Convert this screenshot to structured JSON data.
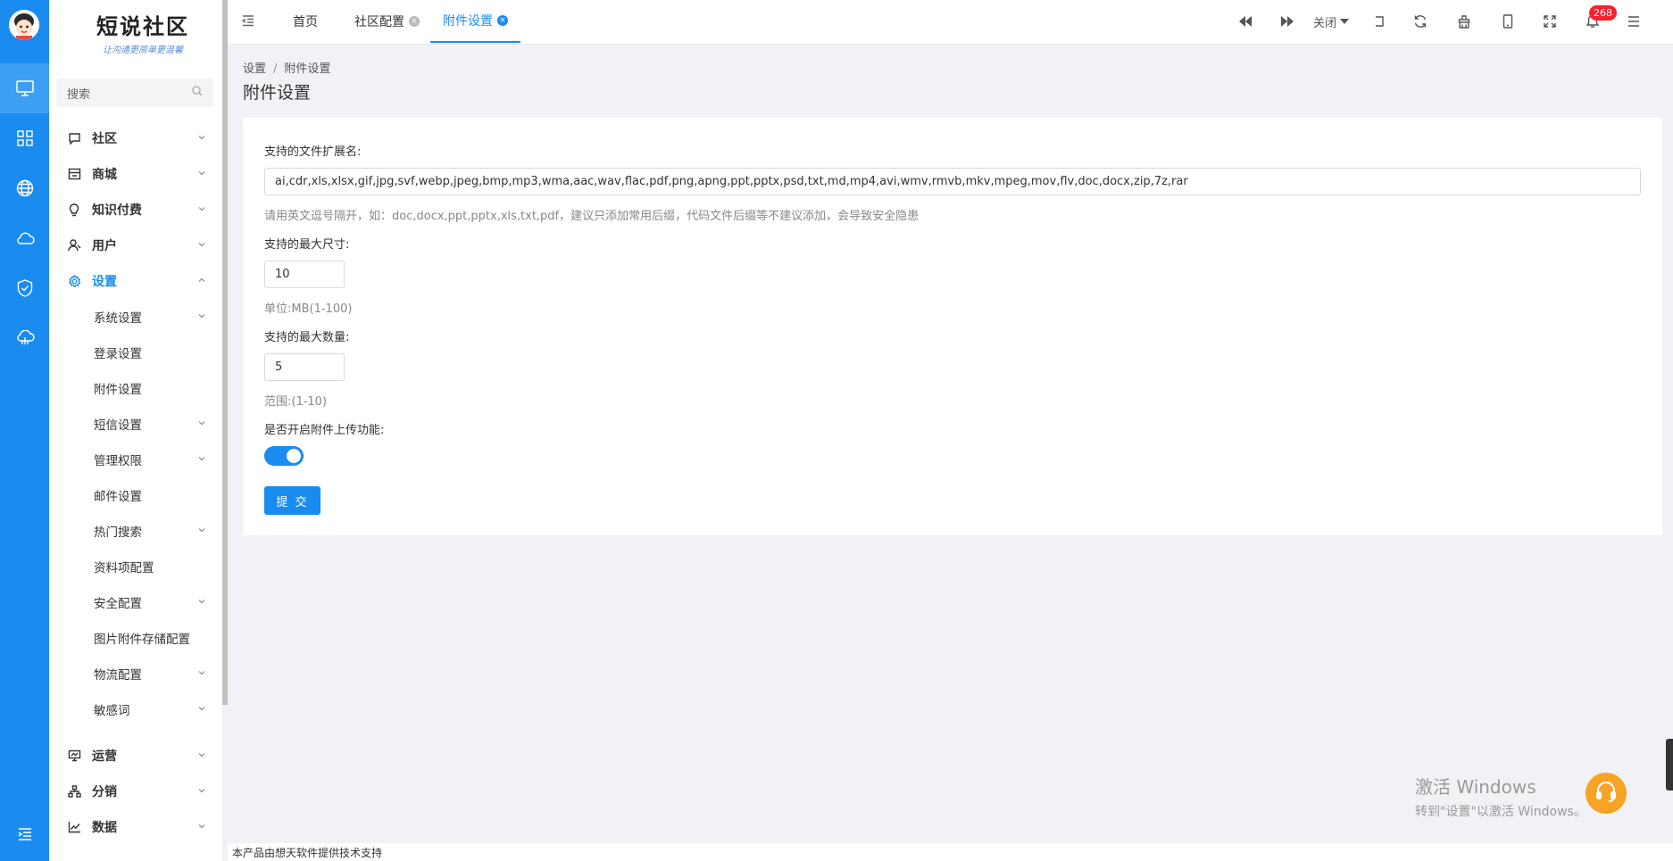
{
  "logo": {
    "title": "短说社区",
    "subtitle": "让沟通更简单更温馨"
  },
  "rail": {
    "items": [
      "monitor-icon",
      "grid-icon",
      "globe-icon",
      "cloud-icon",
      "shield-icon",
      "cloud-network-icon"
    ],
    "bottom": "menu-fold-icon"
  },
  "sidebar": {
    "search_placeholder": "搜索",
    "menu": [
      {
        "label": "社区",
        "icon": "chat-icon"
      },
      {
        "label": "商城",
        "icon": "store-icon"
      },
      {
        "label": "知识付费",
        "icon": "bulb-icon"
      },
      {
        "label": "用户",
        "icon": "user-icon"
      },
      {
        "label": "设置",
        "icon": "gear-icon",
        "active": true
      }
    ],
    "settings_sub": [
      {
        "label": "系统设置",
        "has_children": true
      },
      {
        "label": "登录设置",
        "has_children": false
      },
      {
        "label": "附件设置",
        "has_children": false
      },
      {
        "label": "短信设置",
        "has_children": true
      },
      {
        "label": "管理权限",
        "has_children": true
      },
      {
        "label": "邮件设置",
        "has_children": false
      },
      {
        "label": "热门搜索",
        "has_children": true
      },
      {
        "label": "资料项配置",
        "has_children": false
      },
      {
        "label": "安全配置",
        "has_children": true
      },
      {
        "label": "图片附件存储配置",
        "has_children": false
      },
      {
        "label": "物流配置",
        "has_children": true
      },
      {
        "label": "敏感词",
        "has_children": true
      }
    ],
    "menu_bottom": [
      {
        "label": "运营",
        "icon": "presentation-icon"
      },
      {
        "label": "分销",
        "icon": "org-chart-icon"
      },
      {
        "label": "数据",
        "icon": "line-chart-icon"
      }
    ]
  },
  "topbar": {
    "tabs": [
      {
        "label": "首页",
        "closable": false,
        "active": false
      },
      {
        "label": "社区配置",
        "closable": true,
        "active": false
      },
      {
        "label": "附件设置",
        "closable": true,
        "active": true
      }
    ],
    "close_label": "关闭",
    "notification_count": "268"
  },
  "breadcrumb": {
    "root": "设置",
    "separator": "/",
    "current": "附件设置"
  },
  "page_title": "附件设置",
  "form": {
    "ext_label": "支持的文件扩展名:",
    "ext_value": "ai,cdr,xls,xlsx,gif,jpg,svf,webp,jpeg,bmp,mp3,wma,aac,wav,flac,pdf,png,apng,ppt,pptx,psd,txt,md,mp4,avi,wmv,rmvb,mkv,mpeg,mov,flv,doc,docx,zip,7z,rar",
    "ext_help": "请用英文逗号隔开，如：doc,docx,ppt,pptx,xls,txt,pdf，建议只添加常用后缀，代码文件后缀等不建议添加，会导致安全隐患",
    "size_label": "支持的最大尺寸:",
    "size_value": "10",
    "size_help": "单位:MB(1-100)",
    "count_label": "支持的最大数量:",
    "count_value": "5",
    "count_help": "范围:(1-10)",
    "enable_label": "是否开启附件上传功能:",
    "enable_value": true,
    "submit_label": "提 交"
  },
  "footer": "本产品由想天软件提供技术支持",
  "watermark": {
    "line1": "激活 Windows",
    "line2": "转到\"设置\"以激活 Windows。"
  },
  "colors": {
    "primary": "#1a8cf0",
    "danger": "#f5222d",
    "support": "#f7a326"
  }
}
